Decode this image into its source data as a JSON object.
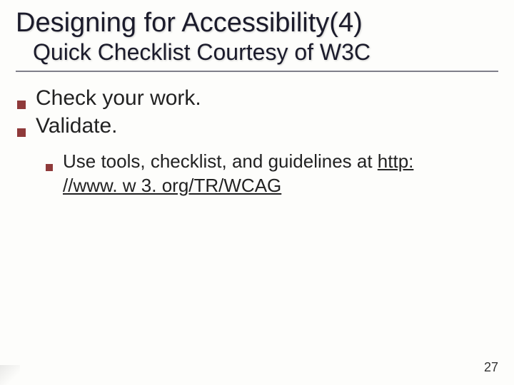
{
  "title": "Designing for Accessibility(4)",
  "subtitle": "Quick Checklist Courtesy of W3C",
  "bullets": {
    "b1": "Check your work.",
    "b2": "Validate.",
    "sub1_pre": "Use tools, checklist, and guidelines at ",
    "sub1_link": "http: //www. w 3. org/TR/WCAG"
  },
  "page_number": "27"
}
